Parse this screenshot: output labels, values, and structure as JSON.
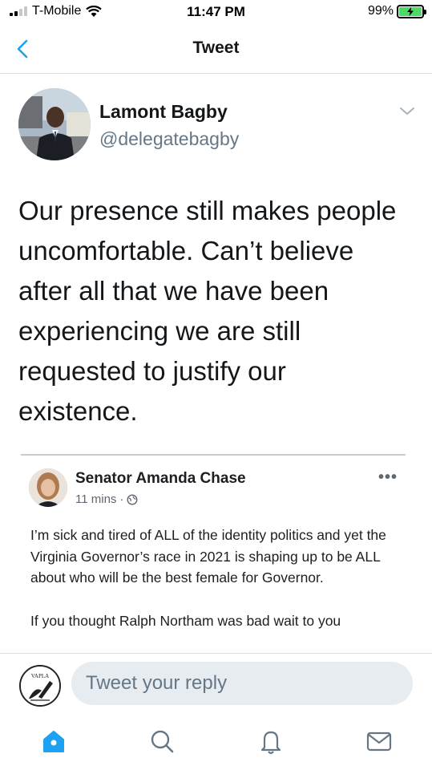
{
  "status_bar": {
    "carrier": "T-Mobile",
    "time": "11:47 PM",
    "battery": "99%",
    "battery_level": 0.99,
    "signal_bars": 2
  },
  "header": {
    "title": "Tweet",
    "back_icon": "chevron-left-icon"
  },
  "tweet": {
    "author_name": "Lamont Bagby",
    "author_handle": "@delegatebagby",
    "text": "Our presence still makes people\nuncomfortable.  Can’t believe\nafter all that we have been\nexperiencing we are still\nrequested to justify our\nexistence."
  },
  "embed": {
    "author_name": "Senator Amanda Chase",
    "time": "11 mins",
    "separator": "·",
    "paragraphs": [
      "I’m sick and tired of ALL of the identity politics and yet the Virginia Governor’s race in 2021 is shaping up to be ALL about who will be the best female for Governor.",
      "If you thought Ralph Northam was bad wait to you"
    ]
  },
  "reply": {
    "placeholder": "Tweet your reply",
    "avatar_text": "VAPLA"
  },
  "tabs": [
    {
      "name": "home-icon"
    },
    {
      "name": "search-icon"
    },
    {
      "name": "notifications-icon"
    },
    {
      "name": "messages-icon"
    }
  ],
  "colors": {
    "accent": "#1da1f2",
    "secondary_text": "#657786",
    "battery_green": "#4cd964",
    "reply_field": "#e6ecf0"
  }
}
